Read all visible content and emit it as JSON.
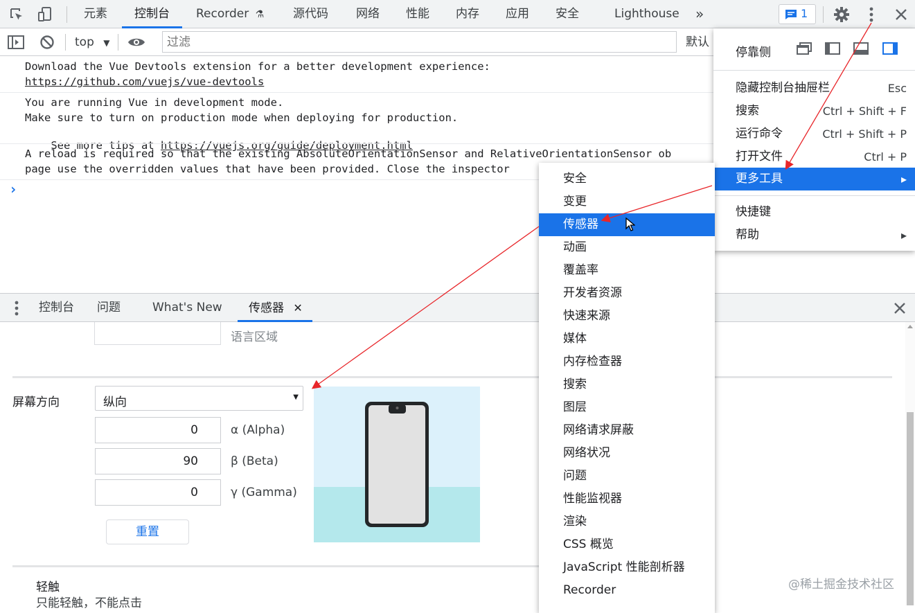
{
  "topbar": {
    "tabs": [
      "元素",
      "控制台",
      "Recorder",
      "源代码",
      "网络",
      "性能",
      "内存",
      "应用",
      "安全",
      "Lighthouse"
    ],
    "active_tab": "控制台",
    "more_tabs": "»",
    "issues_count": "1"
  },
  "console_toolbar": {
    "context": "top",
    "filter_placeholder": "过滤",
    "levels": "默认"
  },
  "console": {
    "msg1_line1": "Download the Vue Devtools extension for a better development experience:",
    "msg1_link": "https://github.com/vuejs/vue-devtools",
    "msg2_line1": "You are running Vue in development mode.",
    "msg2_line2": "Make sure to turn on production mode when deploying for production.",
    "msg2_line3_prefix": "See more tips at ",
    "msg2_link": "https://vuejs.org/guide/deployment.html",
    "msg3_line1": "A reload is required so that the existing AbsoluteOrientationSensor and RelativeOrientationSensor ob",
    "msg3_line2": "page use the overridden values that have been provided. Close the inspector",
    "prompt": "›"
  },
  "drawer": {
    "tabs": [
      "控制台",
      "问题",
      "What's New",
      "传感器"
    ],
    "active_tab": "传感器",
    "locale_label": "语言区域",
    "orientation_label": "屏幕方向",
    "orientation_value": "纵向",
    "alpha_value": "0",
    "alpha_label": "α (Alpha)",
    "beta_value": "90",
    "beta_label": "β (Beta)",
    "gamma_value": "0",
    "gamma_label": "γ (Gamma)",
    "reset_label": "重置",
    "touch_title": "轻触",
    "touch_desc": "只能轻触，不能点击"
  },
  "main_menu": {
    "dock_label": "停靠侧",
    "items": [
      {
        "label": "隐藏控制台抽屉栏",
        "shortcut": "Esc"
      },
      {
        "label": "搜索",
        "shortcut": "Ctrl + Shift + F"
      },
      {
        "label": "运行命令",
        "shortcut": "Ctrl + Shift + P"
      },
      {
        "label": "打开文件",
        "shortcut": "Ctrl + P"
      },
      {
        "label": "更多工具",
        "shortcut": "▸"
      },
      {
        "label": "快捷键",
        "shortcut": ""
      },
      {
        "label": "帮助",
        "shortcut": "▸"
      }
    ]
  },
  "more_tools_menu": {
    "items": [
      "安全",
      "变更",
      "传感器",
      "动画",
      "覆盖率",
      "开发者资源",
      "快速来源",
      "媒体",
      "内存检查器",
      "搜索",
      "图层",
      "网络请求屏蔽",
      "网络状况",
      "问题",
      "性能监视器",
      "渲染",
      "CSS 概览",
      "JavaScript 性能剖析器",
      "Recorder"
    ],
    "highlighted": "传感器"
  },
  "watermark": "@稀土掘金技术社区",
  "colors": {
    "accent": "#1a73e8",
    "annotation_arrow": "#e8262a",
    "phone_sky": "#dcf1fb",
    "phone_ground": "#b4e8ec"
  }
}
